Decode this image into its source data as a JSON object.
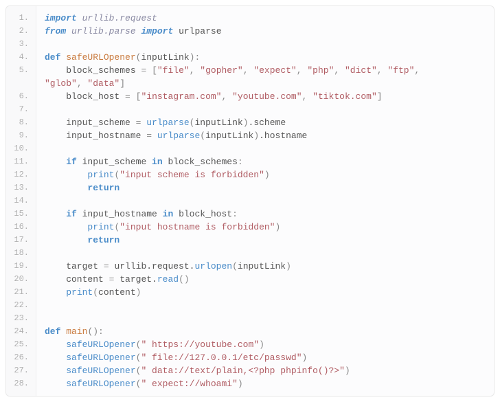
{
  "lineCount": 28,
  "code": {
    "l1": [
      [
        "kw-i",
        "import"
      ],
      [
        "nm",
        " "
      ],
      [
        "mod",
        "urllib.request"
      ]
    ],
    "l2": [
      [
        "kw-i",
        "from"
      ],
      [
        "nm",
        " "
      ],
      [
        "mod",
        "urllib.parse"
      ],
      [
        "nm",
        " "
      ],
      [
        "kw-i",
        "import"
      ],
      [
        "nm",
        " urlparse"
      ]
    ],
    "l3": [
      [
        "nm",
        ""
      ]
    ],
    "l4": [
      [
        "kw",
        "def"
      ],
      [
        "nm",
        " "
      ],
      [
        "fn-def",
        "safeURLOpener"
      ],
      [
        "pun",
        "("
      ],
      [
        "nm",
        "inputLink"
      ],
      [
        "pun",
        "):"
      ]
    ],
    "l5": [
      [
        "nm",
        "    block_schemes "
      ],
      [
        "pun",
        "="
      ],
      [
        "nm",
        " "
      ],
      [
        "pun",
        "["
      ],
      [
        "str",
        "\"file\""
      ],
      [
        "pun",
        ", "
      ],
      [
        "str",
        "\"gopher\""
      ],
      [
        "pun",
        ", "
      ],
      [
        "str",
        "\"expect\""
      ],
      [
        "pun",
        ", "
      ],
      [
        "str",
        "\"php\""
      ],
      [
        "pun",
        ", "
      ],
      [
        "str",
        "\"dict\""
      ],
      [
        "pun",
        ", "
      ],
      [
        "str",
        "\"ftp\""
      ],
      [
        "pun",
        ", "
      ]
    ],
    "l5b": [
      [
        "str",
        "\"glob\""
      ],
      [
        "pun",
        ", "
      ],
      [
        "str",
        "\"data\""
      ],
      [
        "pun",
        "]"
      ]
    ],
    "l6": [
      [
        "nm",
        "    block_host "
      ],
      [
        "pun",
        "="
      ],
      [
        "nm",
        " "
      ],
      [
        "pun",
        "["
      ],
      [
        "str",
        "\"instagram.com\""
      ],
      [
        "pun",
        ", "
      ],
      [
        "str",
        "\"youtube.com\""
      ],
      [
        "pun",
        ", "
      ],
      [
        "str",
        "\"tiktok.com\""
      ],
      [
        "pun",
        "]"
      ]
    ],
    "l7": [
      [
        "nm",
        ""
      ]
    ],
    "l8": [
      [
        "nm",
        "    input_scheme "
      ],
      [
        "pun",
        "="
      ],
      [
        "nm",
        " "
      ],
      [
        "fn",
        "urlparse"
      ],
      [
        "pun",
        "("
      ],
      [
        "nm",
        "inputLink"
      ],
      [
        "pun",
        ")"
      ],
      [
        "nm",
        ".scheme"
      ]
    ],
    "l9": [
      [
        "nm",
        "    input_hostname "
      ],
      [
        "pun",
        "="
      ],
      [
        "nm",
        " "
      ],
      [
        "fn",
        "urlparse"
      ],
      [
        "pun",
        "("
      ],
      [
        "nm",
        "inputLink"
      ],
      [
        "pun",
        ")"
      ],
      [
        "nm",
        ".hostname"
      ]
    ],
    "l10": [
      [
        "nm",
        ""
      ]
    ],
    "l11": [
      [
        "nm",
        "    "
      ],
      [
        "kw",
        "if"
      ],
      [
        "nm",
        " input_scheme "
      ],
      [
        "kw",
        "in"
      ],
      [
        "nm",
        " block_schemes"
      ],
      [
        "pun",
        ":"
      ]
    ],
    "l12": [
      [
        "nm",
        "        "
      ],
      [
        "fn",
        "print"
      ],
      [
        "pun",
        "("
      ],
      [
        "str",
        "\"input scheme is forbidden\""
      ],
      [
        "pun",
        ")"
      ]
    ],
    "l13": [
      [
        "nm",
        "        "
      ],
      [
        "kw",
        "return"
      ]
    ],
    "l14": [
      [
        "nm",
        ""
      ]
    ],
    "l15": [
      [
        "nm",
        "    "
      ],
      [
        "kw",
        "if"
      ],
      [
        "nm",
        " input_hostname "
      ],
      [
        "kw",
        "in"
      ],
      [
        "nm",
        " block_host"
      ],
      [
        "pun",
        ":"
      ]
    ],
    "l16": [
      [
        "nm",
        "        "
      ],
      [
        "fn",
        "print"
      ],
      [
        "pun",
        "("
      ],
      [
        "str",
        "\"input hostname is forbidden\""
      ],
      [
        "pun",
        ")"
      ]
    ],
    "l17": [
      [
        "nm",
        "        "
      ],
      [
        "kw",
        "return"
      ]
    ],
    "l18": [
      [
        "nm",
        ""
      ]
    ],
    "l19": [
      [
        "nm",
        "    target "
      ],
      [
        "pun",
        "="
      ],
      [
        "nm",
        " urllib.request."
      ],
      [
        "fn",
        "urlopen"
      ],
      [
        "pun",
        "("
      ],
      [
        "nm",
        "inputLink"
      ],
      [
        "pun",
        ")"
      ]
    ],
    "l20": [
      [
        "nm",
        "    content "
      ],
      [
        "pun",
        "="
      ],
      [
        "nm",
        " target."
      ],
      [
        "fn",
        "read"
      ],
      [
        "pun",
        "()"
      ]
    ],
    "l21": [
      [
        "nm",
        "    "
      ],
      [
        "fn",
        "print"
      ],
      [
        "pun",
        "("
      ],
      [
        "nm",
        "content"
      ],
      [
        "pun",
        ")"
      ]
    ],
    "l22": [
      [
        "nm",
        ""
      ]
    ],
    "l23": [
      [
        "nm",
        ""
      ]
    ],
    "l24": [
      [
        "kw",
        "def"
      ],
      [
        "nm",
        " "
      ],
      [
        "fn-def",
        "main"
      ],
      [
        "pun",
        "():"
      ]
    ],
    "l25": [
      [
        "nm",
        "    "
      ],
      [
        "fn",
        "safeURLOpener"
      ],
      [
        "pun",
        "("
      ],
      [
        "str",
        "\" https://youtube.com\""
      ],
      [
        "pun",
        ")"
      ]
    ],
    "l26": [
      [
        "nm",
        "    "
      ],
      [
        "fn",
        "safeURLOpener"
      ],
      [
        "pun",
        "("
      ],
      [
        "str",
        "\" file://127.0.0.1/etc/passwd\""
      ],
      [
        "pun",
        ")"
      ]
    ],
    "l27": [
      [
        "nm",
        "    "
      ],
      [
        "fn",
        "safeURLOpener"
      ],
      [
        "pun",
        "("
      ],
      [
        "str",
        "\" data://text/plain,<?php phpinfo()?>\""
      ],
      [
        "pun",
        ")"
      ]
    ],
    "l28": [
      [
        "nm",
        "    "
      ],
      [
        "fn",
        "safeURLOpener"
      ],
      [
        "pun",
        "("
      ],
      [
        "str",
        "\" expect://whoami\""
      ],
      [
        "pun",
        ")"
      ]
    ]
  },
  "lineOrder": [
    "l1",
    "l2",
    "l3",
    "l4",
    "l5",
    "l5b",
    "l6",
    "l7",
    "l8",
    "l9",
    "l10",
    "l11",
    "l12",
    "l13",
    "l14",
    "l15",
    "l16",
    "l17",
    "l18",
    "l19",
    "l20",
    "l21",
    "l22",
    "l23",
    "l24",
    "l25",
    "l26",
    "l27",
    "l28"
  ],
  "gutterDot": "."
}
